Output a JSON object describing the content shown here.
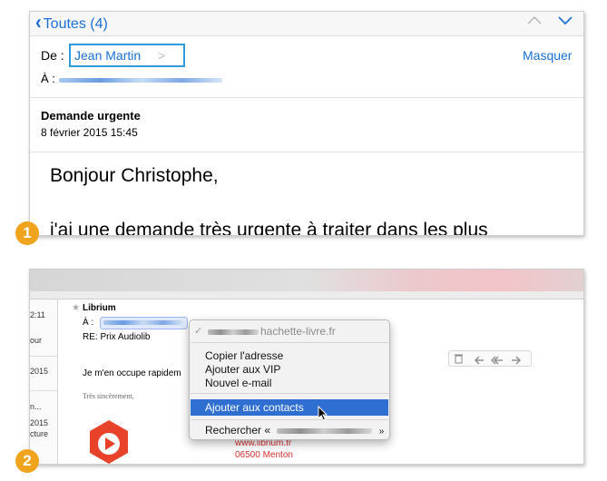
{
  "panel1": {
    "nav": {
      "back_label": "Toutes (4)",
      "masquer": "Masquer"
    },
    "from_label": "De :",
    "from_name": "Jean Martin",
    "from_chevron": ">",
    "to_label": "À :",
    "subject": "Demande urgente",
    "date": "8 février 2015 15:45",
    "greeting": "Bonjour Christophe,",
    "body_line": "j'ai une demande très urgente à traiter dans les plus"
  },
  "panel2": {
    "list_items": [
      "2:11",
      "our",
      "2015",
      "n...",
      "2015",
      "cture"
    ],
    "star": "★",
    "sender": "Librium",
    "to_label": "À :",
    "subject": "RE: Prix Audiolib",
    "reply_text": "Je m'en occupe rapidem",
    "signature_text": "Très sincèrement,",
    "website": "www.librium.fr",
    "address": "06500 Menton"
  },
  "context_menu": {
    "check": "✓",
    "email_domain": "hachette-livre.fr",
    "items": [
      "Copier l'adresse",
      "Ajouter aux VIP",
      "Nouvel e-mail"
    ],
    "highlighted": "Ajouter aux contacts",
    "search_prefix": "Rechercher «",
    "search_suffix": "»"
  },
  "steps": [
    "1",
    "2"
  ],
  "colors": {
    "ios_blue": "#1a6fd6",
    "step_orange": "#f0a31c",
    "menu_highlight": "#2f6fd1",
    "logo_red": "#e8432a"
  }
}
